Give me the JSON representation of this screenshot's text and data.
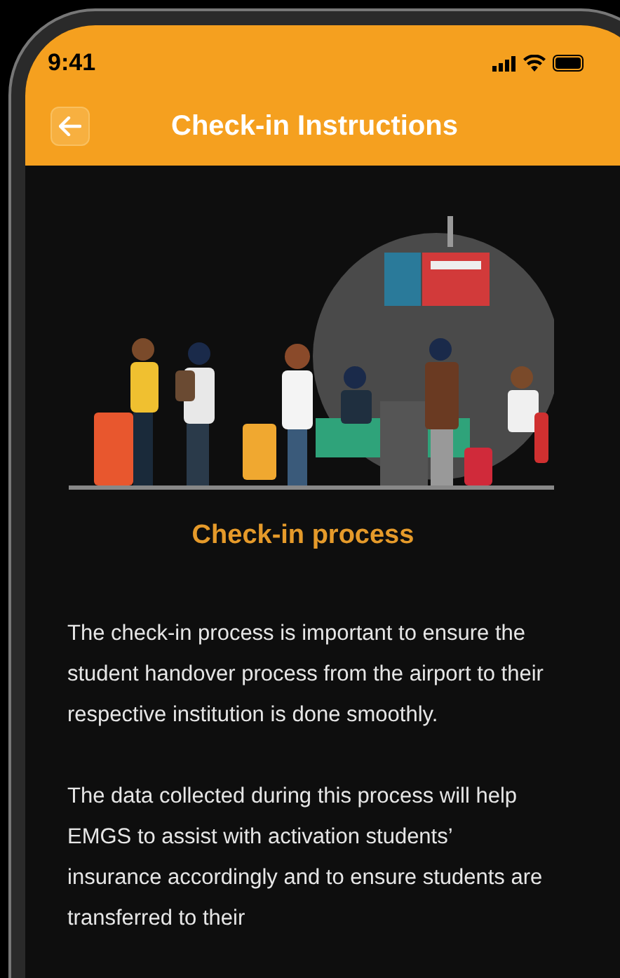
{
  "status_bar": {
    "time": "9:41"
  },
  "header": {
    "title": "Check-in Instructions"
  },
  "section": {
    "heading": "Check-in process"
  },
  "paragraphs": [
    "The check-in process is important to ensure the student handover process from the airport to their respective institution is done smoothly.",
    "The data collected during this process will help EMGS to assist with activation students’ insurance accordingly and to ensure students are transferred to their"
  ]
}
